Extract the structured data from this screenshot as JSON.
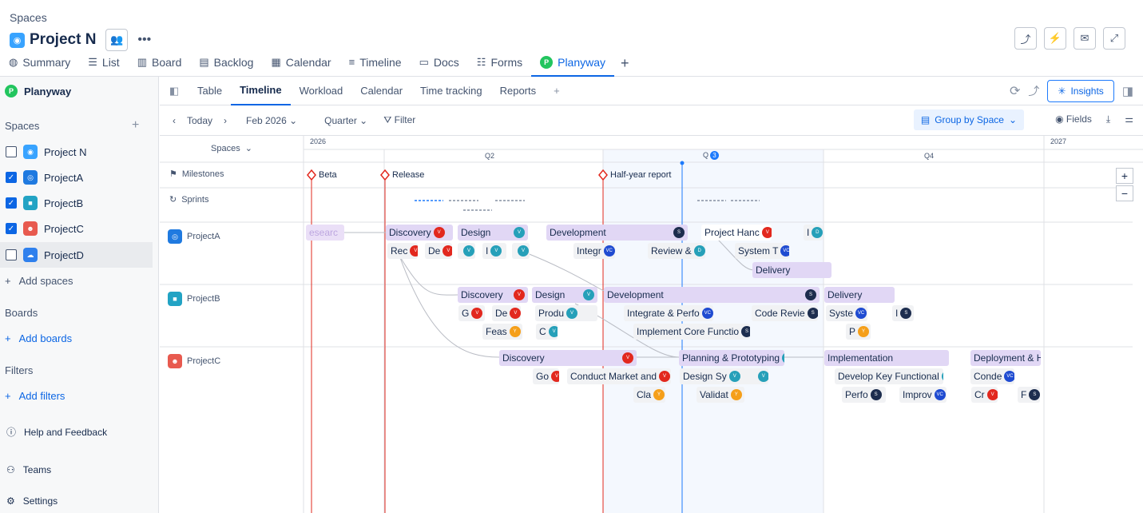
{
  "header": {
    "crumb": "Spaces",
    "title": "Project N"
  },
  "tabs": [
    "Summary",
    "List",
    "Board",
    "Backlog",
    "Calendar",
    "Timeline",
    "Docs",
    "Forms",
    "Planyway"
  ],
  "sidebar": {
    "app": "Planyway",
    "spaces_label": "Spaces",
    "spaces": [
      {
        "name": "Project N",
        "checked": false
      },
      {
        "name": "ProjectA",
        "checked": true
      },
      {
        "name": "ProjectB",
        "checked": true
      },
      {
        "name": "ProjectC",
        "checked": true
      },
      {
        "name": "ProjectD",
        "checked": false
      }
    ],
    "add_spaces": "Add spaces",
    "boards_label": "Boards",
    "add_boards": "Add boards",
    "filters_label": "Filters",
    "add_filters": "Add filters",
    "help": "Help and Feedback",
    "teams": "Teams",
    "settings": "Settings"
  },
  "views": [
    "Table",
    "Timeline",
    "Workload",
    "Calendar",
    "Time tracking",
    "Reports"
  ],
  "insights": "Insights",
  "toolbar": {
    "today": "Today",
    "date": "Feb 2026",
    "scale": "Quarter",
    "filter": "Filter",
    "group": "Group by Space",
    "fields": "Fields"
  },
  "timeline": {
    "spaces_label": "Spaces",
    "year1": "2026",
    "year2": "2027",
    "q2": "Q2",
    "q3": "Q",
    "q3_badge": "3",
    "q4": "Q4",
    "milestones_label": "Milestones",
    "sprints_label": "Sprints",
    "milestones": [
      "Beta",
      "Release",
      "Half-year report"
    ],
    "rows": [
      "ProjectA",
      "ProjectB",
      "ProjectC"
    ]
  }
}
